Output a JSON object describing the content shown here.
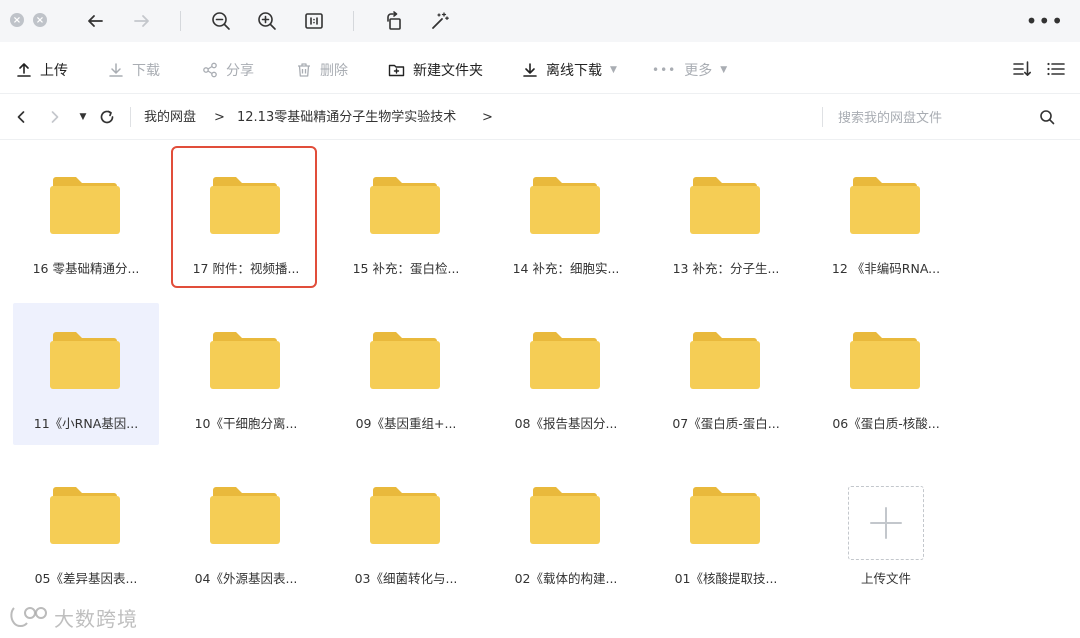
{
  "toolbar": {
    "upload": "上传",
    "download": "下载",
    "share": "分享",
    "delete": "删除",
    "new_folder": "新建文件夹",
    "offline_download": "离线下载",
    "more": "更多"
  },
  "breadcrumb": {
    "root": "我的网盘",
    "separator": ">",
    "current": "12.13零基础精通分子生物学实验技术"
  },
  "search": {
    "placeholder": "搜索我的网盘文件"
  },
  "folders": [
    {
      "label": "16 零基础精通分..."
    },
    {
      "label": "17 附件：视频播..."
    },
    {
      "label": "15 补充：蛋白检..."
    },
    {
      "label": "14 补充：细胞实..."
    },
    {
      "label": "13 补充：分子生..."
    },
    {
      "label": "12 《非编码RNA..."
    },
    {
      "label": "11《小RNA基因..."
    },
    {
      "label": "10《干细胞分离..."
    },
    {
      "label": "09《基因重组+..."
    },
    {
      "label": "08《报告基因分..."
    },
    {
      "label": "07《蛋白质-蛋白..."
    },
    {
      "label": "06《蛋白质-核酸..."
    },
    {
      "label": "05《差异基因表..."
    },
    {
      "label": "04《外源基因表..."
    },
    {
      "label": "03《细菌转化与..."
    },
    {
      "label": "02《载体的构建..."
    },
    {
      "label": "01《核酸提取技..."
    }
  ],
  "upload_tile": {
    "label": "上传文件"
  },
  "watermark": {
    "text": "大数跨境"
  },
  "colors": {
    "folder_body": "#f5cd55",
    "folder_tab": "#e9b93c",
    "selected_bg": "#eef1fd",
    "highlight_border": "#e14d3a"
  }
}
